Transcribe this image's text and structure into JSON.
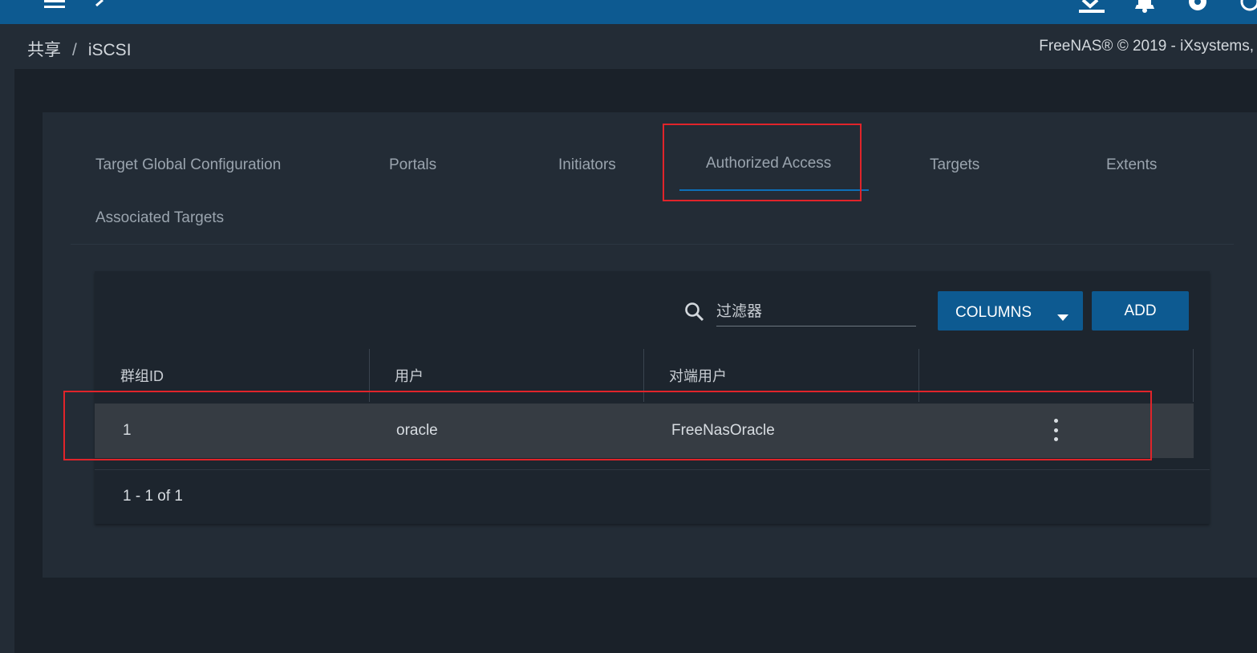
{
  "header": {
    "icons": [
      "menu-icon",
      "back-icon",
      "download-icon",
      "bell-icon",
      "gear-icon",
      "power-icon"
    ]
  },
  "breadcrumb": {
    "parent": "共享",
    "separator": "/",
    "current": "iSCSI"
  },
  "copyright": "FreeNAS® © 2019 - iXsystems,",
  "tabs": [
    {
      "label": "Target Global Configuration"
    },
    {
      "label": "Portals"
    },
    {
      "label": "Initiators"
    },
    {
      "label": "Authorized Access",
      "active": true
    },
    {
      "label": "Targets"
    },
    {
      "label": "Extents"
    },
    {
      "label": "Associated Targets"
    }
  ],
  "toolbar": {
    "filter_placeholder": "过滤器",
    "columns_label": "COLUMNS",
    "add_label": "ADD"
  },
  "table": {
    "columns": [
      "群组ID",
      "用户",
      "对端用户",
      ""
    ],
    "rows": [
      {
        "group_id": "1",
        "user": "oracle",
        "peer_user": "FreeNasOracle"
      }
    ]
  },
  "paginator": "1 - 1 of 1",
  "colors": {
    "accent": "#0d5a91",
    "highlight_box": "#e0242a",
    "tab_underline": "#0d6fb8"
  }
}
